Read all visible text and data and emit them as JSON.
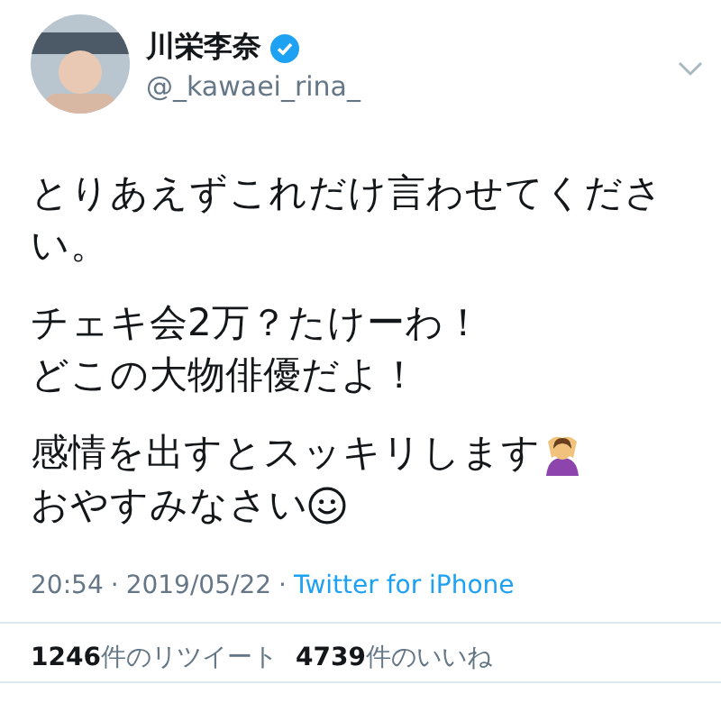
{
  "author": {
    "name": "川栄李奈",
    "verified": true,
    "handle": "@_kawaei_rina_"
  },
  "body": [
    {
      "lines": [
        {
          "text": "とりあえずこれだけ言わせてください。"
        }
      ]
    },
    {
      "lines": [
        {
          "text": "チェキ会2万？たけーわ！"
        },
        {
          "text": "どこの大物俳優だよ！"
        }
      ]
    },
    {
      "lines": [
        {
          "text": "感情を出すとスッキリします",
          "kind": "gesture"
        },
        {
          "text": "おやすみなさい",
          "kind": "smiley"
        }
      ]
    }
  ],
  "meta": [
    {
      "kind": "time",
      "text": "20:54"
    },
    {
      "kind": "separator",
      "text": "·"
    },
    {
      "kind": "date",
      "text": "2019/05/22"
    },
    {
      "kind": "separator",
      "text": "·"
    },
    {
      "kind": "source",
      "text": "Twitter for iPhone"
    }
  ],
  "stats": [
    {
      "count": "1246",
      "label": "件のリツイート"
    },
    {
      "count": "4739",
      "label": "件のいいね"
    }
  ]
}
